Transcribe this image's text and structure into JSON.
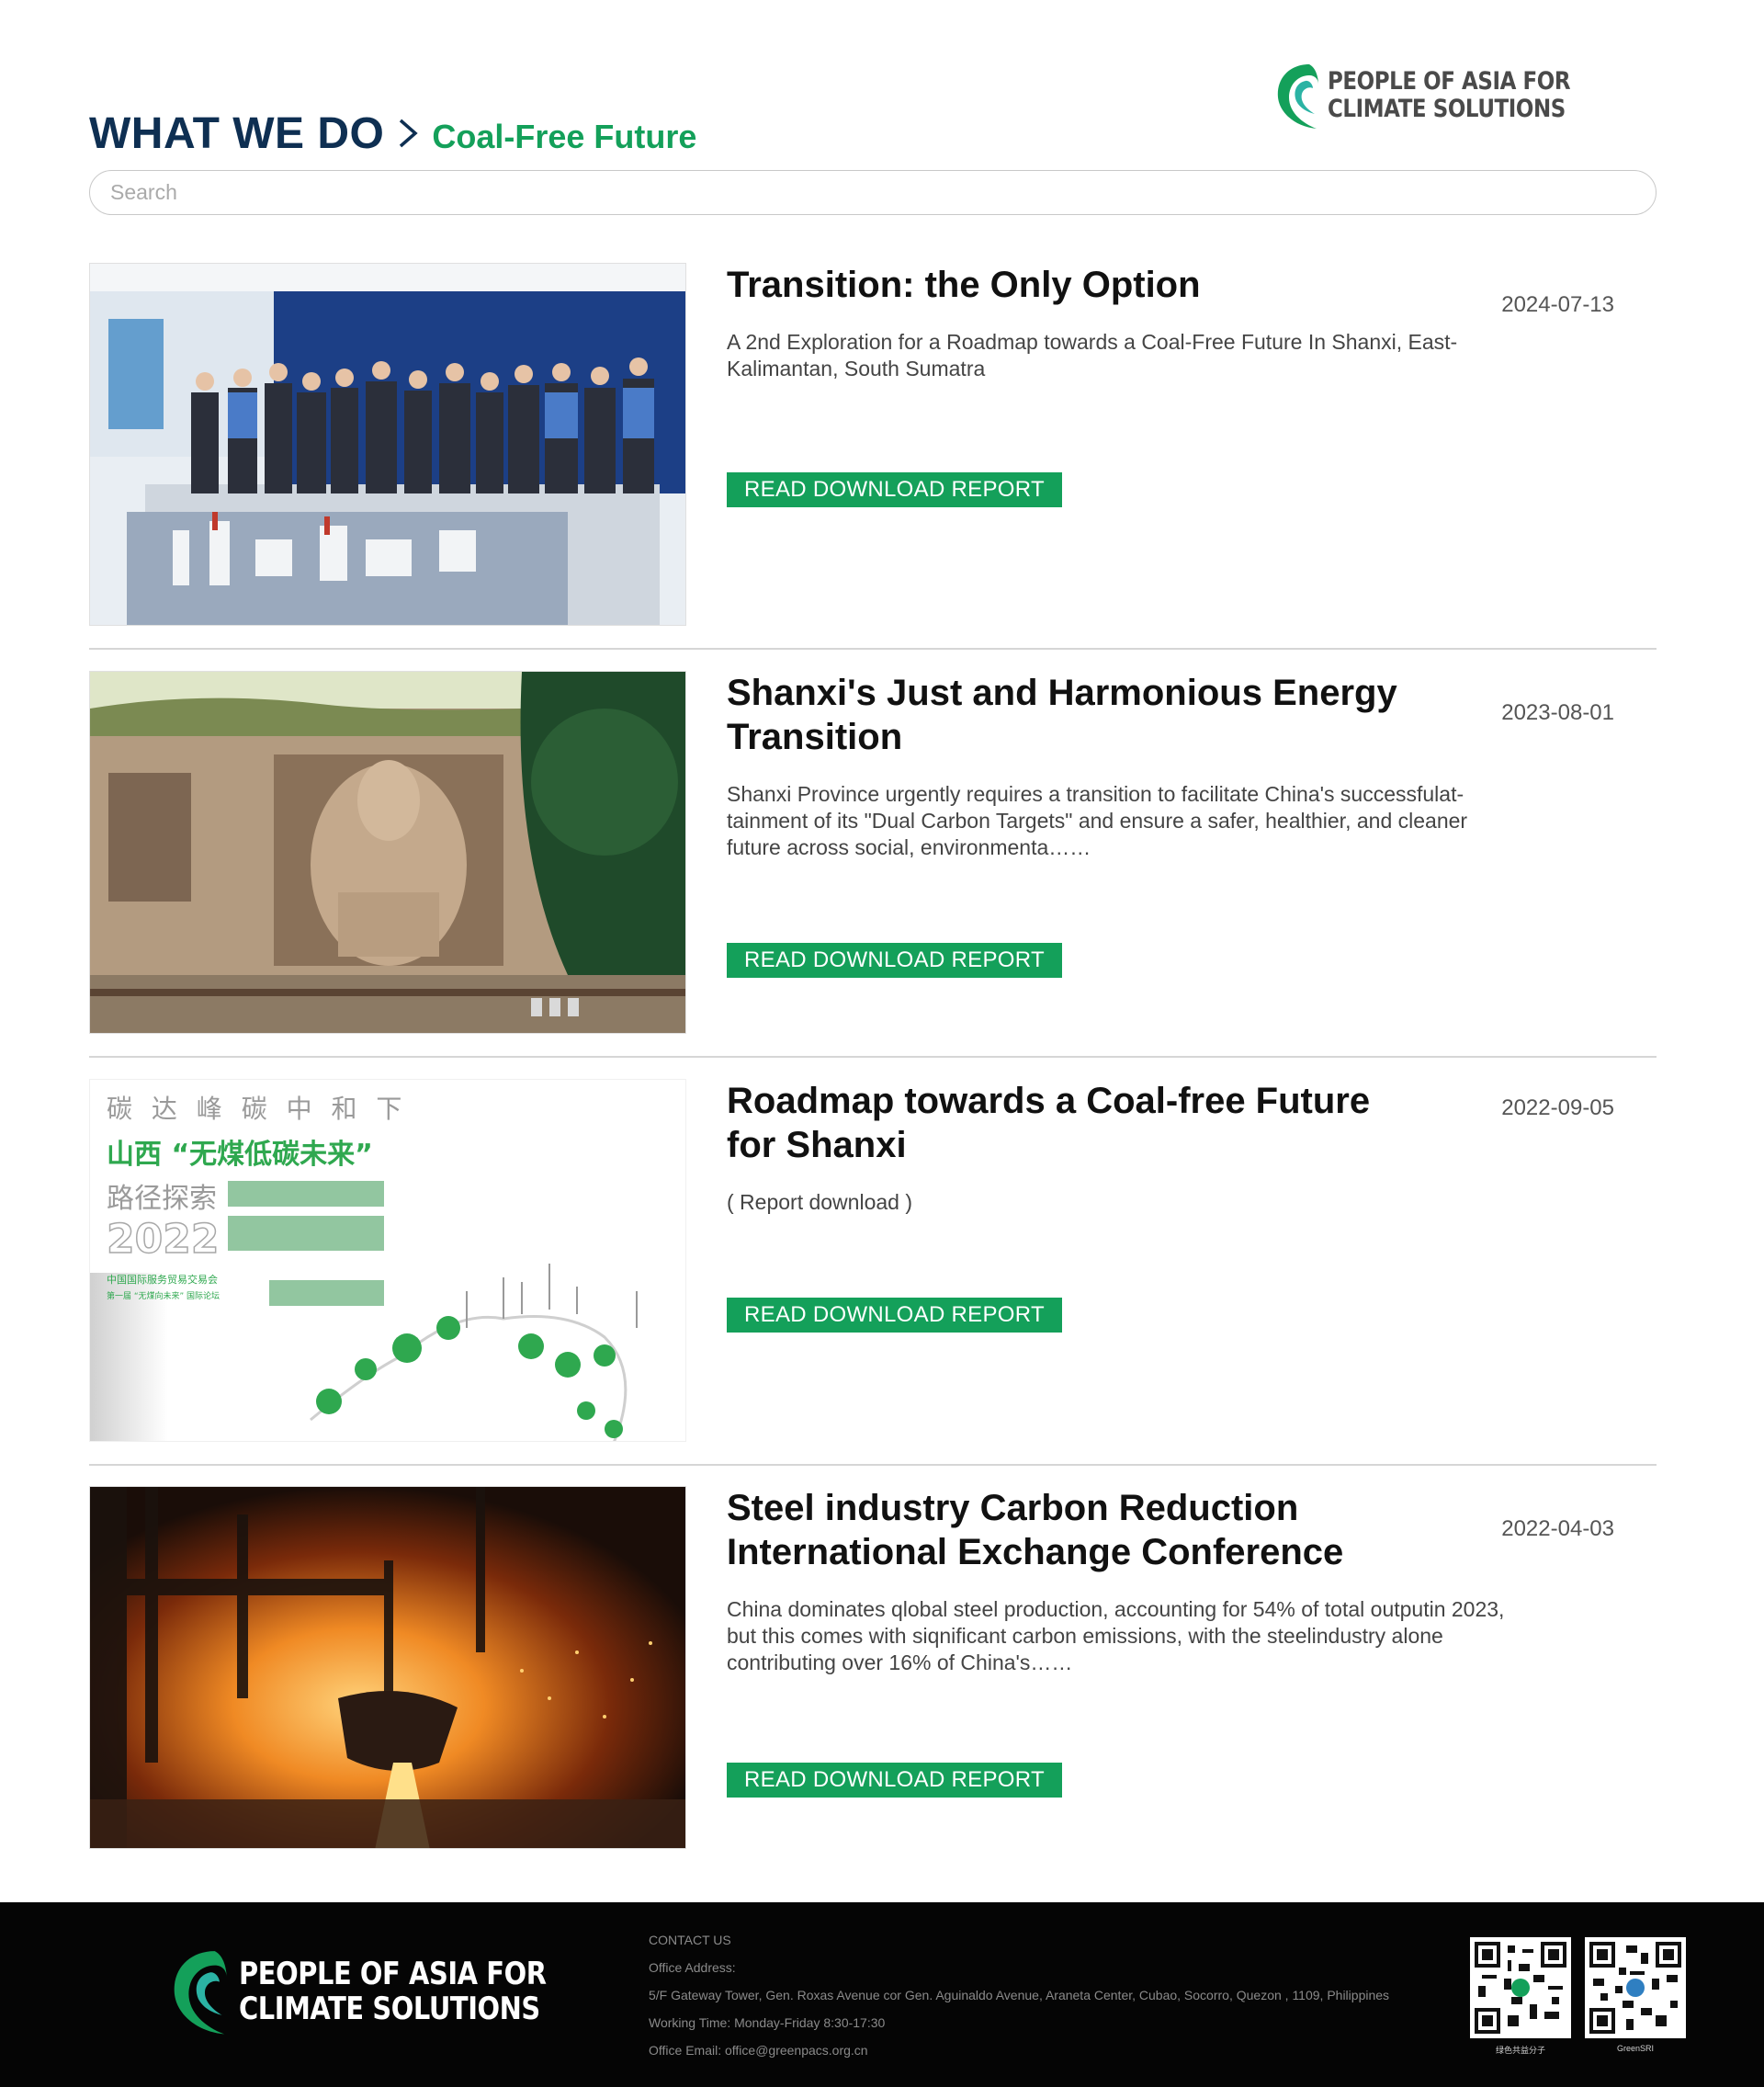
{
  "brand": {
    "name_line1": "PEOPLE OF ASIA FOR",
    "name_line2": "CLIMATE SOLUTIONS",
    "color_primary": "#14a05a",
    "color_dark": "#0e2f52"
  },
  "breadcrumb": {
    "section": "WHAT WE DO",
    "separator_icon": "chevron-right-icon",
    "current": "Coal-Free Future"
  },
  "search": {
    "placeholder": "Search",
    "value": ""
  },
  "articles": [
    {
      "title": "Transition: the Only Option",
      "date": "2024-07-13",
      "description": "A 2nd Exploration for a Roadmap towards a Coal-Free Future In Shanxi, East-Kalimantan, South Sumatra",
      "button": "READ DOWNLOAD REPORT",
      "image": "photo-delegation-visiting-power-plant-model"
    },
    {
      "title": "Shanxi's Just and Harmonious Energy Transition",
      "date": "2023-08-01",
      "description": "Shanxi Province urgently requires a transition to facilitate China's successfulat-tainment of its \"Dual Carbon Targets\" and ensure a safer, healthier, and cleaner future across social, environmenta……",
      "button": "READ DOWNLOAD REPORT",
      "image": "photo-yungang-grottoes-buddha"
    },
    {
      "title": "Roadmap towards a Coal-free Future for Shanxi",
      "date": "2022-09-05",
      "description": "( Report download )",
      "button": "READ DOWNLOAD REPORT",
      "image": "report-cover-shanxi-roadmap",
      "cover_text": {
        "line1": "碳 达 峰 碳 中 和 下",
        "line2": "山西 “无煤低碳未来”",
        "line3": "路径探索",
        "line4": "2022",
        "line5": "中国国际服务贸易交易会",
        "line6": "第一届 “无煤向未来” 国际论坛"
      }
    },
    {
      "title": "Steel industry Carbon Reduction International Exchange Conference",
      "date": "2022-04-03",
      "description": "China dominates qlobal steel production, accounting for 54% of total outputin 2023, but this comes with siqnificant carbon emissions, with the steelindustry alone contributing over 16% of China's……",
      "button": "READ DOWNLOAD REPORT",
      "image": "photo-molten-steel-furnace"
    }
  ],
  "footer": {
    "contact_heading": "CONTACT US",
    "address_label": "Office Address:",
    "address": "5/F Gateway Tower, Gen. Roxas Avenue cor Gen. Aguinaldo Avenue, Araneta Center, Cubao, Socorro, Quezon , 1109, Philippines",
    "hours": "Working Time: Monday-Friday 8:30-17:30",
    "email": "Office Email: office@greenpacs.org.cn",
    "qr1_label": "绿色共益分子",
    "qr2_label": "GreenSRI"
  }
}
